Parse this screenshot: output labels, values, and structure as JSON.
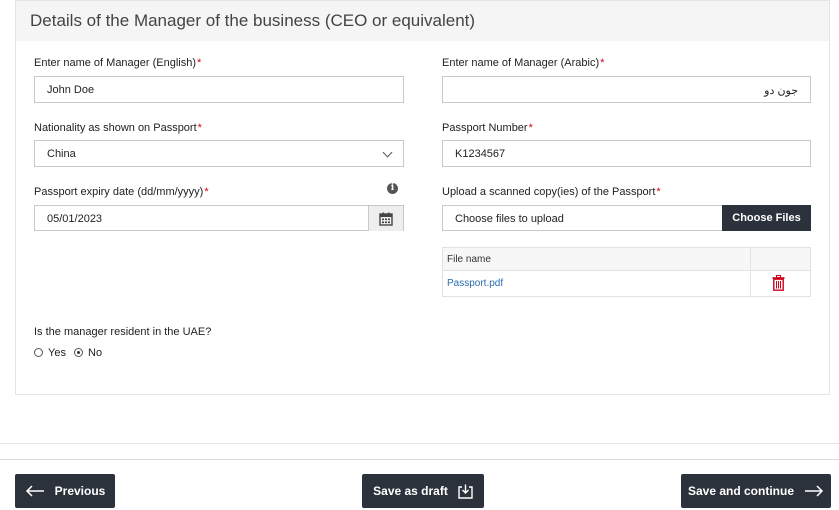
{
  "section": {
    "title": "Details of the Manager of the business (CEO or equivalent)"
  },
  "fields": {
    "name_en": {
      "label": "Enter name of Manager (English)",
      "value": "John Doe"
    },
    "name_ar": {
      "label": "Enter name of Manager (Arabic)",
      "value": "جون دو"
    },
    "nationality": {
      "label": "Nationality as shown on Passport",
      "value": "China"
    },
    "passport_number": {
      "label": "Passport Number",
      "value": "K1234567"
    },
    "passport_expiry": {
      "label": "Passport expiry date (dd/mm/yyyy)",
      "value": "05/01/2023"
    },
    "passport_upload": {
      "label": "Upload a scanned copy(ies) of the Passport",
      "placeholder": "Choose files to upload",
      "button": "Choose Files"
    }
  },
  "required_mark": "*",
  "files": {
    "header": "File name",
    "items": [
      "Passport.pdf"
    ]
  },
  "resident": {
    "question": "Is the manager resident in the UAE?",
    "options": [
      "Yes",
      "No"
    ],
    "selected": "No"
  },
  "footer": {
    "previous": "Previous",
    "save_draft": "Save as draft",
    "save_continue": "Save and continue"
  },
  "colors": {
    "dark_button": "#2c323c",
    "required": "#d0021b",
    "link": "#2a6db0",
    "delete": "#d0021b"
  },
  "icons": [
    "info-icon",
    "calendar-icon",
    "trash-icon",
    "arrow-left-icon",
    "download-icon",
    "arrow-right-icon",
    "chevron-down-icon"
  ]
}
